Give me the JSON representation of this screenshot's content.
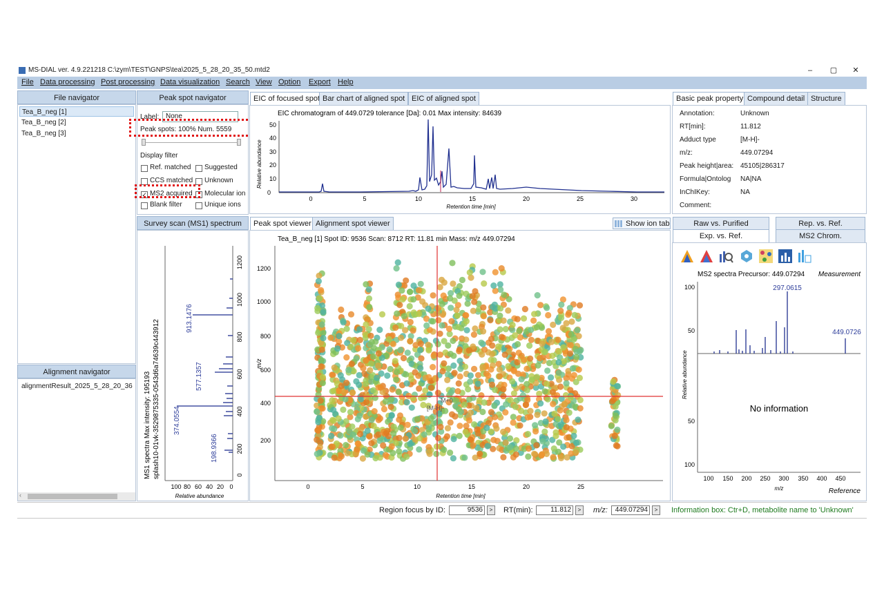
{
  "window": {
    "title": "MS-DIAL ver. 4.9.221218 C:\\zym\\TEST\\GNPS\\tea\\2025_5_28_20_35_50.mtd2",
    "minimize": "–",
    "restore": "▢",
    "close": "✕"
  },
  "menu": [
    "File",
    "Data processing",
    "Post processing",
    "Data visualization",
    "Search",
    "View",
    "Option",
    "Export",
    "Help"
  ],
  "file_navigator": {
    "title": "File navigator",
    "files": [
      "Tea_B_neg [1]",
      "Tea_B_neg [2]",
      "Tea_B_neg [3]"
    ]
  },
  "alignment_navigator": {
    "title": "Alignment navigator",
    "items": [
      "alignmentResult_2025_5_28_20_36"
    ]
  },
  "peak_spot_navigator": {
    "title": "Peak spot navigator",
    "label_caption": "Label:",
    "label_value": "None",
    "peak_spots": "Peak spots: 100%  Num. 5559",
    "display_filter": "Display filter",
    "filters": [
      {
        "label": "Ref. matched",
        "checked": false
      },
      {
        "label": "Suggested",
        "checked": false
      },
      {
        "label": "CCS matched",
        "checked": false
      },
      {
        "label": "Unknown",
        "checked": false
      },
      {
        "label": "MS2 acquired",
        "checked": true
      },
      {
        "label": "Molecular ion",
        "checked": false
      },
      {
        "label": "Blank filter",
        "checked": false
      },
      {
        "label": "Unique ions",
        "checked": false
      }
    ]
  },
  "eic_tabs": [
    "EIC of focused spot",
    "Bar chart of aligned spot",
    "EIC of aligned spot"
  ],
  "eic_chart": {
    "title": "EIC chromatogram of 449.0729 tolerance [Da]: 0.01  Max intensity: 84639",
    "ylabel": "Relative abundance",
    "xlabel": "Retention time [min]",
    "xticks": [
      "0",
      "5",
      "10",
      "15",
      "20",
      "25",
      "30"
    ],
    "yticks": [
      "0",
      "10",
      "20",
      "30",
      "40",
      "50"
    ]
  },
  "property_tabs": [
    "Basic peak property",
    "Compound detail",
    "Structure"
  ],
  "properties": [
    {
      "key": "Annotation:",
      "value": "Unknown"
    },
    {
      "key": "RT[min]:",
      "value": "11.812"
    },
    {
      "key": "Adduct type",
      "value": "[M-H]-"
    },
    {
      "key": "m/z:",
      "value": "449.07294"
    },
    {
      "key": "Peak height|area:",
      "value": "45105|286317"
    },
    {
      "key": "Formula|Ontolog",
      "value": "NA|NA"
    },
    {
      "key": "InChIKey:",
      "value": "NA"
    },
    {
      "key": "Comment:",
      "value": ""
    }
  ],
  "survey_scan": {
    "title": "Survey scan (MS1) spectrum",
    "vlabel1": "MS1 spectra Max intensity: 195193",
    "vlabel2": "splash10-01vk-3529875335-0543d6a74639c443912",
    "xlabel": "Relative abundance",
    "xticks": [
      "100",
      "80",
      "60",
      "40",
      "20",
      "0"
    ],
    "mzticks": [
      "0",
      "200",
      "400",
      "600",
      "800",
      "1000",
      "1200"
    ],
    "peak_labels": [
      "913.1476",
      "577.1357",
      "374.0554",
      "198.9366"
    ]
  },
  "viewer_tabs": [
    "Peak spot viewer",
    "Alignment spot viewer"
  ],
  "show_ion_table": "Show ion tab",
  "spot_viewer": {
    "header": "Tea_B_neg [1]  Spot ID: 9536  Scan: 8712  RT: 11.81 min  Mass: m/z 449.07294",
    "xlabel": "Retention time [min]",
    "ylabel": "m/z",
    "xticks": [
      "0",
      "5",
      "10",
      "15",
      "20",
      "25"
    ],
    "yticks": [
      "200",
      "400",
      "600",
      "800",
      "1000",
      "1200"
    ],
    "adduct1": "M+0",
    "adduct2": "[M-H]-"
  },
  "ms2_tabs_row1": [
    "Raw vs. Purified",
    "Rep. vs. Ref."
  ],
  "ms2_tabs_row2": [
    "Exp. vs. Ref.",
    "MS2 Chrom."
  ],
  "ms2_panel": {
    "title": "MS2 spectra Precursor: 449.07294",
    "measurement": "Measurement",
    "reference": "Reference",
    "no_info": "No information",
    "ylabel": "Relative abundance",
    "xlabel": "m/z",
    "yticks_top": [
      "100",
      "50"
    ],
    "yticks_bottom": [
      "50",
      "100"
    ],
    "xticks": [
      "100",
      "150",
      "200",
      "250",
      "300",
      "350",
      "400",
      "450"
    ],
    "peak_label1": "297.0615",
    "peak_label2": "449.0726"
  },
  "tool_icons": [
    "spectrum-icon",
    "mirror-spectrum-icon",
    "search-icon",
    "molecule-icon",
    "network-icon",
    "binvestigate-icon",
    "lipid-quant-icon"
  ],
  "statusbar": {
    "region_focus_label": "Region focus by ID:",
    "id_value": "9536",
    "rt_label": "RT(min):",
    "rt_value": "11.812",
    "mz_label": "m/z:",
    "mz_value": "449.07294",
    "go": ">",
    "info": "Information box: Ctr+D, metabolite name to 'Unknown'"
  },
  "colors": {
    "accent": "#b9cde4",
    "highlight": "#e01010",
    "line": "#1f2f8f",
    "info": "#1e7a1e"
  }
}
